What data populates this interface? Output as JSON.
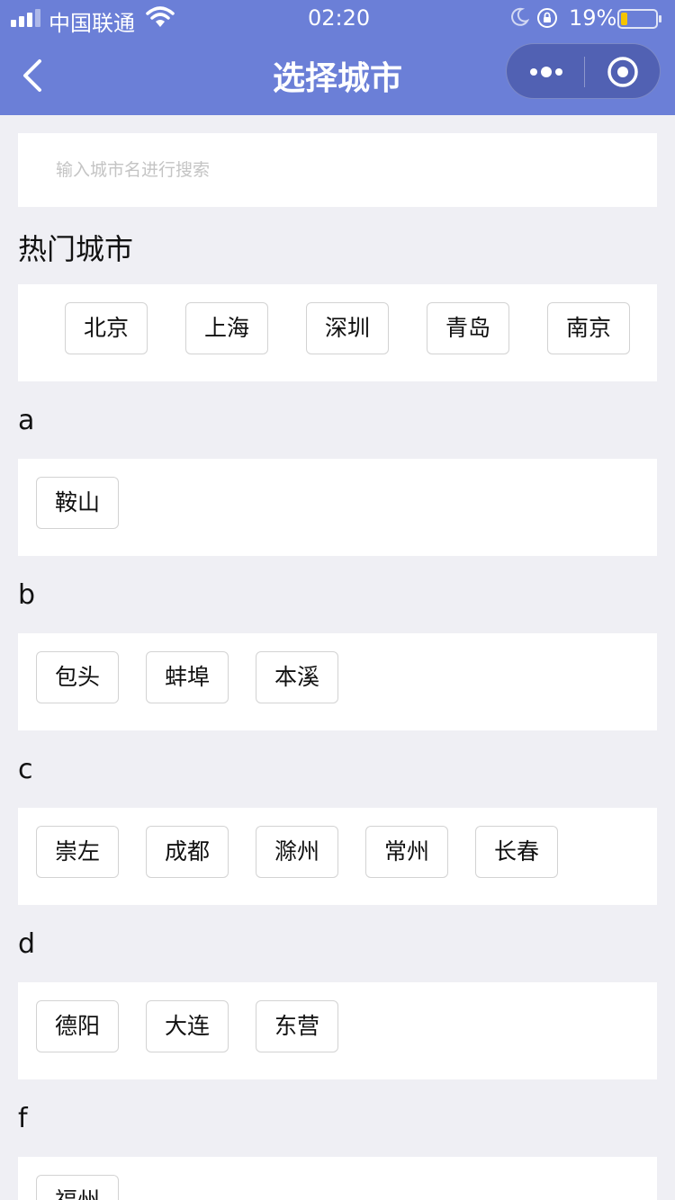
{
  "status_bar": {
    "carrier": "中国联通",
    "time": "02:20",
    "battery_percent": "19%",
    "battery_level": 0.19
  },
  "nav": {
    "title": "选择城市"
  },
  "search": {
    "placeholder": "输入城市名进行搜索",
    "value": ""
  },
  "hot": {
    "title": "热门城市",
    "cities": [
      "北京",
      "上海",
      "深圳",
      "青岛",
      "南京"
    ]
  },
  "groups": [
    {
      "letter": "a",
      "cities": [
        "鞍山"
      ]
    },
    {
      "letter": "b",
      "cities": [
        "包头",
        "蚌埠",
        "本溪"
      ]
    },
    {
      "letter": "c",
      "cities": [
        "崇左",
        "成都",
        "滁州",
        "常州",
        "长春"
      ]
    },
    {
      "letter": "d",
      "cities": [
        "德阳",
        "大连",
        "东营"
      ]
    },
    {
      "letter": "f",
      "cities": [
        "福州"
      ]
    }
  ],
  "colors": {
    "header": "#6b7fd7",
    "background": "#efeff4",
    "battery_fill": "#f5c400"
  }
}
